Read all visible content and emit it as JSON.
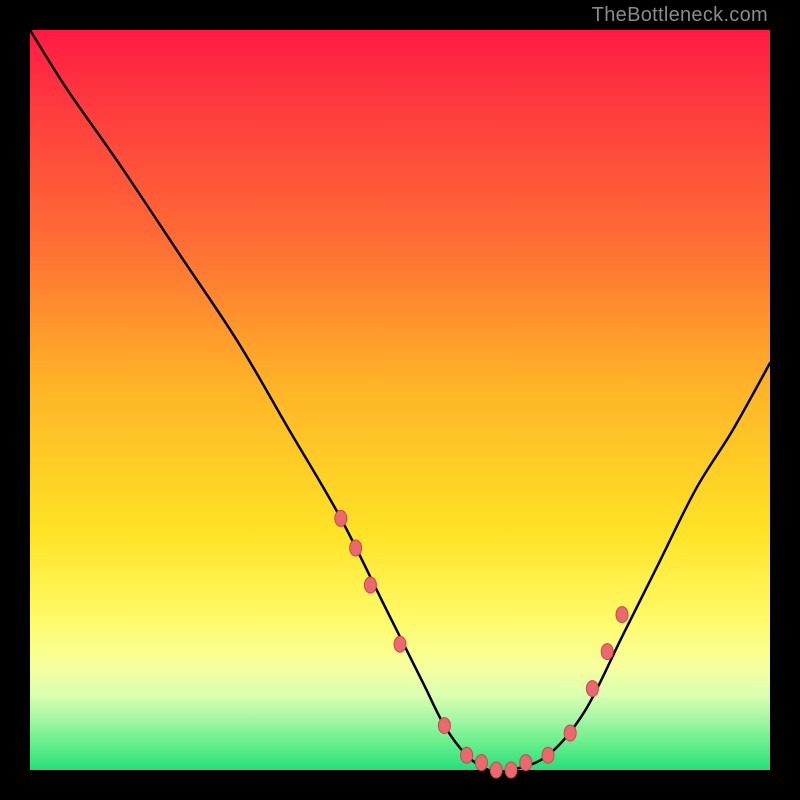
{
  "watermark": "TheBottleneck.com",
  "chart_data": {
    "type": "line",
    "title": "",
    "xlabel": "",
    "ylabel": "",
    "xlim": [
      0,
      100
    ],
    "ylim": [
      0,
      100
    ],
    "series": [
      {
        "name": "bottleneck-curve",
        "x": [
          0,
          5,
          12,
          20,
          28,
          35,
          42,
          48,
          53,
          56,
          59,
          62,
          65,
          70,
          75,
          80,
          85,
          90,
          95,
          100
        ],
        "y": [
          100,
          92,
          82,
          70,
          58,
          46,
          34,
          22,
          12,
          6,
          2,
          0,
          0,
          2,
          8,
          18,
          28,
          38,
          46,
          55
        ]
      }
    ],
    "markers": {
      "name": "highlight-points",
      "x": [
        42,
        44,
        46,
        50,
        56,
        59,
        61,
        63,
        65,
        67,
        70,
        73,
        76,
        78,
        80
      ],
      "y": [
        34,
        30,
        25,
        17,
        6,
        2,
        1,
        0,
        0,
        1,
        2,
        5,
        11,
        16,
        21
      ]
    },
    "colors": {
      "curve": "#000000",
      "marker_fill": "#e86a6f",
      "marker_stroke": "#c9474d",
      "gradient_top": "#ff1a44",
      "gradient_bottom": "#24e07a"
    }
  }
}
